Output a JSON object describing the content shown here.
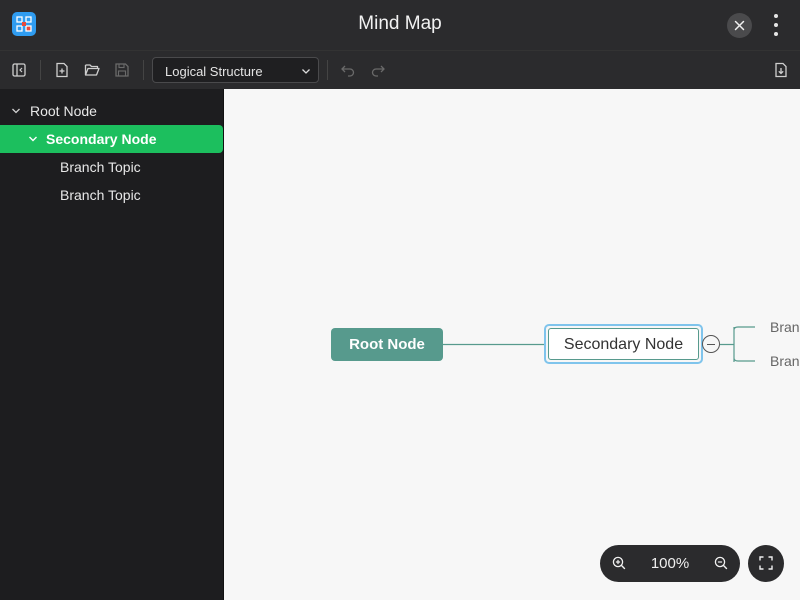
{
  "window": {
    "title": "Mind Map",
    "app_icon": "mindmap-app-icon",
    "close_icon": "close-icon",
    "more_icon": "more-vertical-icon"
  },
  "toolbar": {
    "icons": [
      "sidebar-toggle-icon",
      "new-file-icon",
      "open-folder-icon",
      "save-icon",
      "undo-icon",
      "redo-icon",
      "export-icon"
    ],
    "structure_select": {
      "value": "Logical Structure"
    }
  },
  "sidebar": {
    "items": [
      {
        "label": "Root Node",
        "expanded": true,
        "selected": false,
        "level": 0
      },
      {
        "label": "Secondary Node",
        "expanded": true,
        "selected": true,
        "level": 1
      },
      {
        "label": "Branch Topic",
        "expanded": false,
        "selected": false,
        "level": 2
      },
      {
        "label": "Branch Topic",
        "expanded": false,
        "selected": false,
        "level": 2
      }
    ]
  },
  "canvas": {
    "root_node": "Root Node",
    "secondary_node": "Secondary Node",
    "branches": [
      "Bran",
      "Bran"
    ]
  },
  "zoom": {
    "level": "100%",
    "zoom_in_icon": "zoom-in-icon",
    "zoom_out_icon": "zoom-out-icon",
    "fullscreen_icon": "fullscreen-icon"
  },
  "colors": {
    "selected_green": "#1cbf5e",
    "root_node_fill": "#579a8d",
    "selection_outline": "#7fc4ec",
    "app_icon_blue": "#2f9cf0"
  }
}
